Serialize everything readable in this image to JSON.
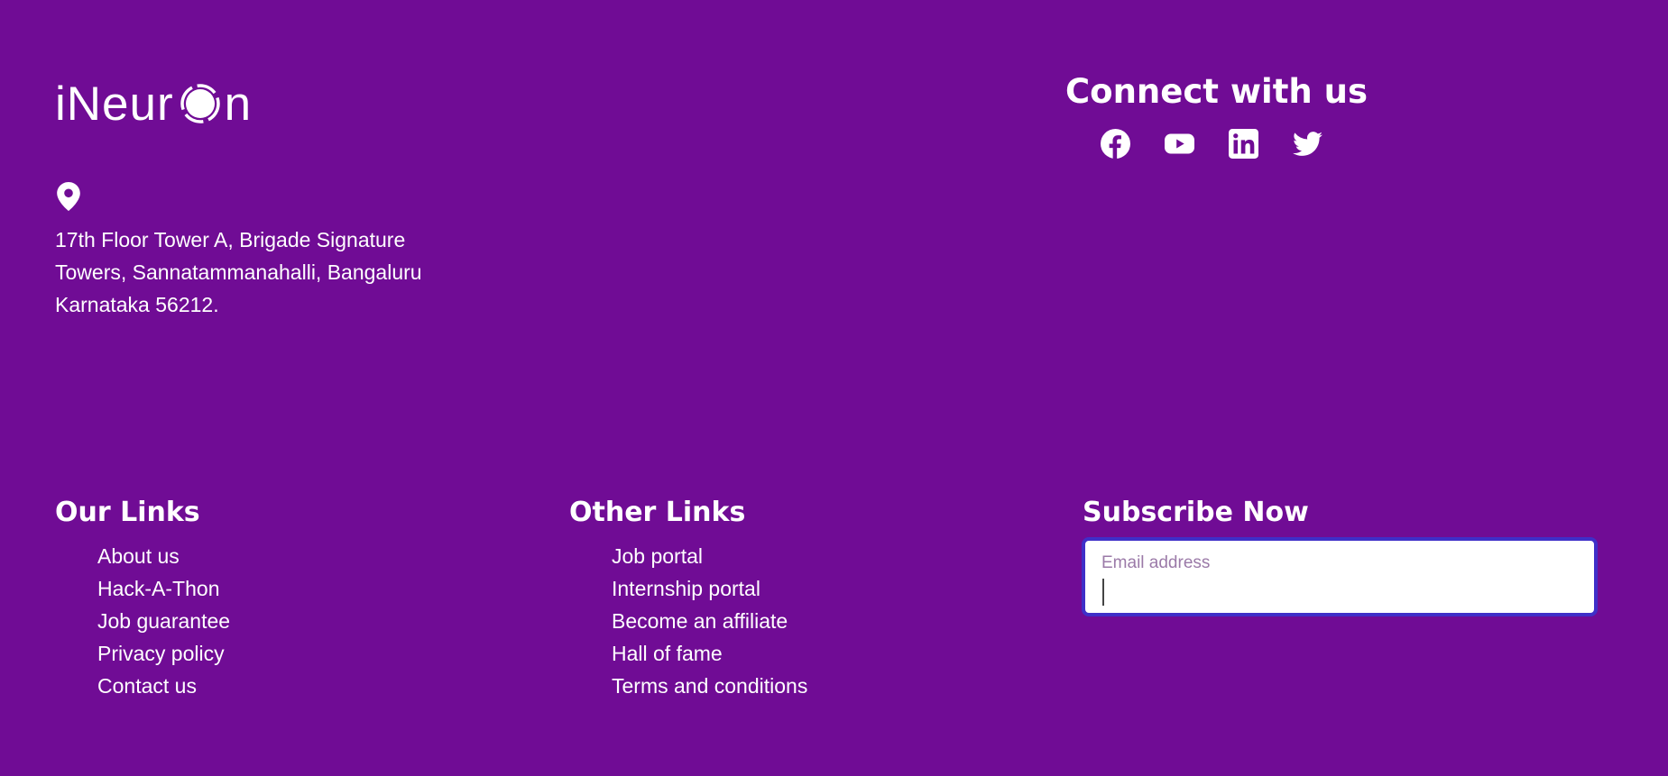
{
  "brand": {
    "logo_prefix": "iNeur",
    "logo_suffix": "n"
  },
  "address": {
    "line1": "17th Floor Tower A, Brigade Signature",
    "line2": "Towers, Sannatammanahalli, Bangaluru",
    "line3": "Karnataka 56212."
  },
  "connect": {
    "title": "Connect with us",
    "icons": [
      "facebook-icon",
      "youtube-icon",
      "linkedin-icon",
      "twitter-icon"
    ]
  },
  "our_links": {
    "title": "Our Links",
    "items": [
      "About us",
      "Hack-A-Thon",
      "Job guarantee",
      "Privacy policy",
      "Contact us"
    ]
  },
  "other_links": {
    "title": "Other Links",
    "items": [
      "Job portal",
      "Internship portal",
      "Become an affiliate",
      "Hall of fame",
      "Terms and conditions"
    ]
  },
  "subscribe": {
    "title": "Subscribe Now",
    "placeholder": "Email address"
  },
  "colors": {
    "background": "#700c95",
    "input_border": "#3f2fc8",
    "text": "#ffffff"
  }
}
